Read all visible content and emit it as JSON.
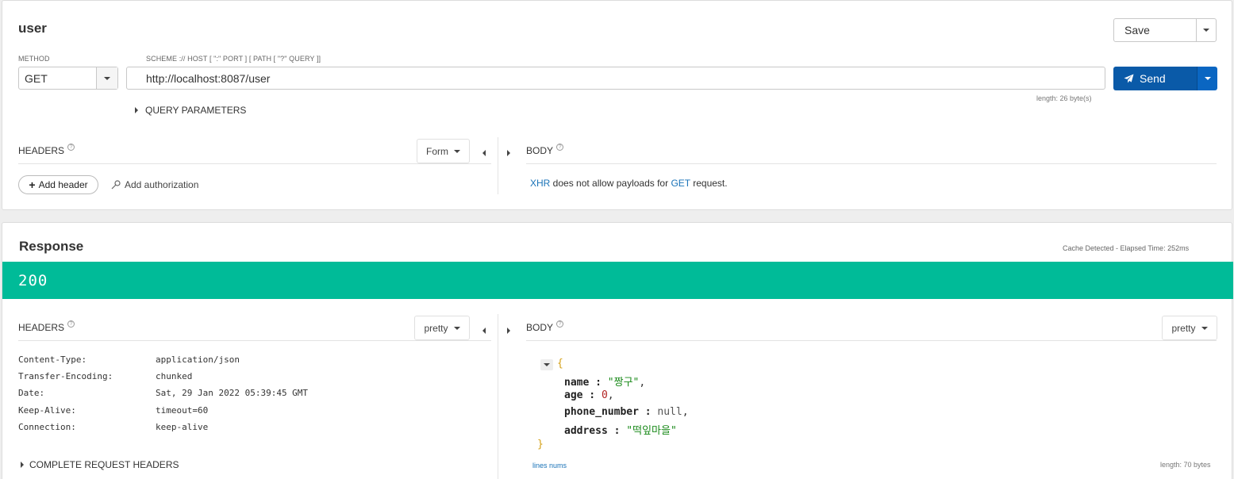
{
  "request": {
    "title": "user",
    "save_label": "Save",
    "method_label": "METHOD",
    "method_value": "GET",
    "url_label": "SCHEME :// HOST [ \":\" PORT ] [ PATH [ \"?\" QUERY ]]",
    "url_value": "http://localhost:8087/user",
    "url_length": "length: 26 byte(s)",
    "send_label": "Send",
    "query_params_label": "QUERY PARAMETERS",
    "headers_label": "HEADERS",
    "headers_mode": "Form",
    "add_header_label": "Add header",
    "add_auth_label": "Add authorization",
    "body_label": "BODY",
    "body_message": {
      "part1": "XHR",
      "part2": " does not allow payloads for ",
      "part3": "GET",
      "part4": " request."
    }
  },
  "response": {
    "title": "Response",
    "timing": "Cache Detected - Elapsed Time: 252ms",
    "status_code": "200",
    "status_color": "#00bb98",
    "headers_label": "HEADERS",
    "headers_mode": "pretty",
    "body_label": "BODY",
    "body_mode": "pretty",
    "headers": [
      {
        "key": "Content-Type:",
        "value": "application/json"
      },
      {
        "key": "Transfer-Encoding:",
        "value": "chunked"
      },
      {
        "key": "Date:",
        "value": "Sat, 29 Jan 2022 05:39:45 GMT"
      },
      {
        "key": "Keep-Alive:",
        "value": "timeout=60"
      },
      {
        "key": "Connection:",
        "value": "keep-alive"
      }
    ],
    "complete_headers_label": "COMPLETE REQUEST HEADERS",
    "json": {
      "open_brace": "{",
      "close_brace": "}",
      "fields": [
        {
          "key": "name",
          "value": "\"짱구\"",
          "type": "string",
          "comma": ","
        },
        {
          "key": "age",
          "value": "0",
          "type": "number",
          "comma": ","
        },
        {
          "key": "phone_number",
          "value": "null",
          "type": "null",
          "comma": ","
        },
        {
          "key": "address",
          "value": "\"떡잎마을\"",
          "type": "string",
          "comma": ""
        }
      ]
    },
    "lines_nums_label": "lines nums",
    "body_length": "length: 70 bytes"
  },
  "colors": {
    "accent": "#0a5aa8",
    "accent_dark": "#074a8c",
    "status": "#00bb98",
    "link": "#1a73b8"
  }
}
